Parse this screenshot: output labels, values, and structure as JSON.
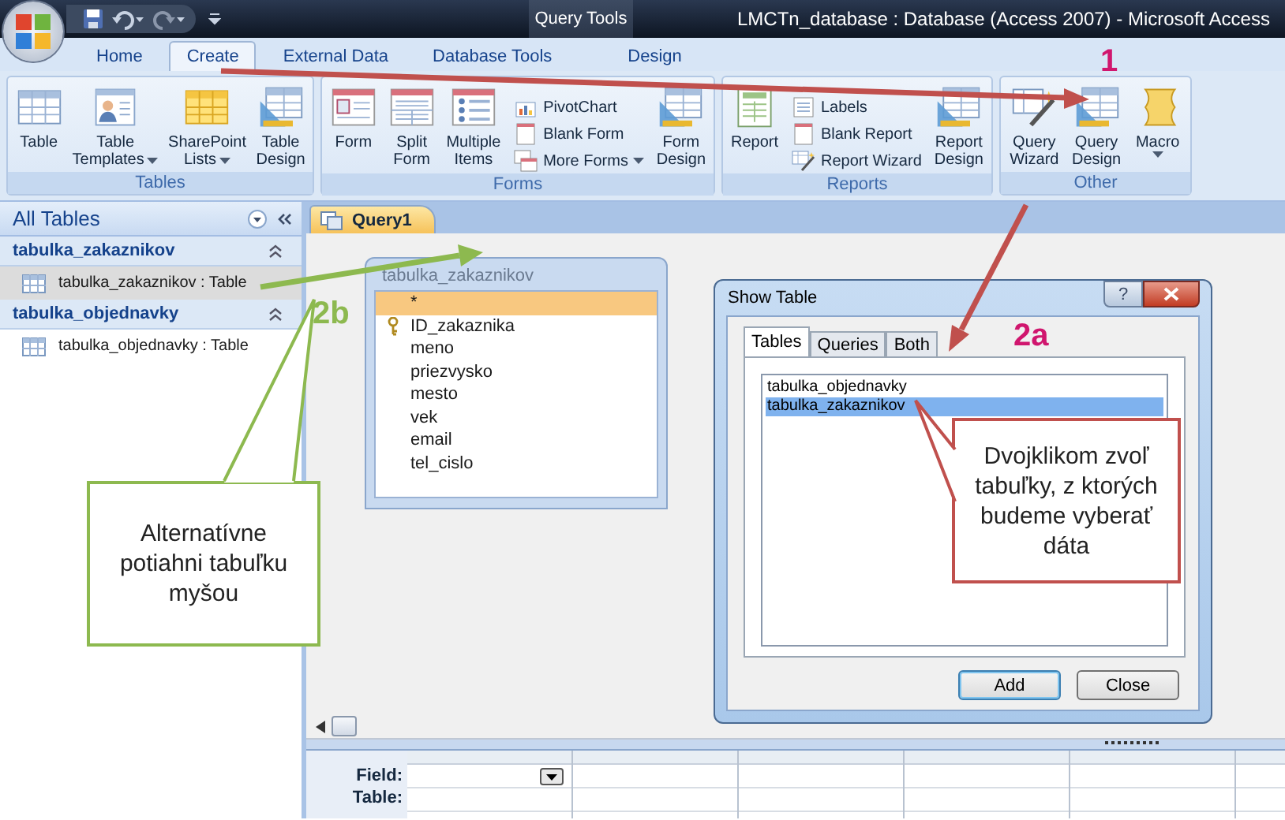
{
  "window": {
    "title": "LMCTn_database : Database (Access 2007) - Microsoft Access",
    "contextual_tab": "Query Tools"
  },
  "ribbon_tabs": [
    {
      "label": "Home",
      "selected": false
    },
    {
      "label": "Create",
      "selected": true
    },
    {
      "label": "External Data",
      "selected": false
    },
    {
      "label": "Database Tools",
      "selected": false
    },
    {
      "label": "Design",
      "selected": false
    }
  ],
  "ribbon_groups": [
    {
      "label": "Tables",
      "commands": [
        {
          "kind": "large",
          "lines": [
            "Table"
          ],
          "dropdown": false
        },
        {
          "kind": "large",
          "lines": [
            "Table",
            "Templates"
          ],
          "dropdown": true
        },
        {
          "kind": "large",
          "lines": [
            "SharePoint",
            "Lists"
          ],
          "dropdown": true
        },
        {
          "kind": "large",
          "lines": [
            "Table",
            "Design"
          ],
          "dropdown": false
        }
      ]
    },
    {
      "label": "Forms",
      "commands": [
        {
          "kind": "large",
          "lines": [
            "Form"
          ],
          "dropdown": false
        },
        {
          "kind": "large",
          "lines": [
            "Split",
            "Form"
          ],
          "dropdown": false
        },
        {
          "kind": "large",
          "lines": [
            "Multiple",
            "Items"
          ],
          "dropdown": false
        },
        {
          "kind": "stack",
          "items": [
            {
              "label": "PivotChart",
              "dropdown": false
            },
            {
              "label": "Blank Form",
              "dropdown": false
            },
            {
              "label": "More Forms",
              "dropdown": true
            }
          ]
        },
        {
          "kind": "large",
          "lines": [
            "Form",
            "Design"
          ],
          "dropdown": false
        }
      ]
    },
    {
      "label": "Reports",
      "commands": [
        {
          "kind": "large",
          "lines": [
            "Report"
          ],
          "dropdown": false
        },
        {
          "kind": "stack",
          "items": [
            {
              "label": "Labels",
              "dropdown": false
            },
            {
              "label": "Blank Report",
              "dropdown": false
            },
            {
              "label": "Report Wizard",
              "dropdown": false
            }
          ]
        },
        {
          "kind": "large",
          "lines": [
            "Report",
            "Design"
          ],
          "dropdown": false
        }
      ]
    },
    {
      "label": "Other",
      "commands": [
        {
          "kind": "large",
          "lines": [
            "Query",
            "Wizard"
          ],
          "dropdown": false
        },
        {
          "kind": "large",
          "lines": [
            "Query",
            "Design"
          ],
          "dropdown": false
        },
        {
          "kind": "large",
          "lines": [
            "Macro"
          ],
          "dropdown": true
        }
      ]
    }
  ],
  "navigation": {
    "title": "All Tables",
    "groups": [
      {
        "label": "tabulka_zakaznikov",
        "expanded": true,
        "items": [
          {
            "label": "tabulka_zakaznikov : Table",
            "selected": true
          }
        ]
      },
      {
        "label": "tabulka_objednavky",
        "expanded": true,
        "items": [
          {
            "label": "tabulka_objednavky : Table",
            "selected": false
          }
        ]
      }
    ]
  },
  "document_tabs": [
    {
      "label": "Query1",
      "selected": true
    }
  ],
  "field_list": {
    "title": "tabulka_zakaznikov",
    "fields": [
      {
        "name": "*",
        "selected": true,
        "primary_key": false
      },
      {
        "name": "ID_zakaznika",
        "selected": false,
        "primary_key": true
      },
      {
        "name": "meno",
        "selected": false,
        "primary_key": false
      },
      {
        "name": "priezvysko",
        "selected": false,
        "primary_key": false
      },
      {
        "name": "mesto",
        "selected": false,
        "primary_key": false
      },
      {
        "name": "vek",
        "selected": false,
        "primary_key": false
      },
      {
        "name": "email",
        "selected": false,
        "primary_key": false
      },
      {
        "name": "tel_cislo",
        "selected": false,
        "primary_key": false
      }
    ]
  },
  "design_grid": {
    "row_labels": [
      "Field:",
      "Table:"
    ]
  },
  "dialog": {
    "title": "Show Table",
    "help_glyph": "?",
    "tabs": [
      {
        "label": "Tables",
        "selected": true
      },
      {
        "label": "Queries",
        "selected": false
      },
      {
        "label": "Both",
        "selected": false
      }
    ],
    "items": [
      {
        "label": "tabulka_objednavky",
        "selected": false
      },
      {
        "label": "tabulka_zakaznikov",
        "selected": true
      }
    ],
    "buttons": [
      {
        "label": "Add",
        "default": true
      },
      {
        "label": "Close",
        "default": false
      }
    ]
  },
  "annotations": [
    {
      "kind": "step",
      "text": "1",
      "color": "#d0166e"
    },
    {
      "kind": "step",
      "text": "2a",
      "color": "#d0166e"
    },
    {
      "kind": "step",
      "text": "2b",
      "color": "#8db94f"
    },
    {
      "kind": "callout",
      "text": "Alternatívne potiahni tabuľku myšou",
      "color": "#8db94f"
    },
    {
      "kind": "callout",
      "text": "Dvojklikom zvoľ tabuľky, z ktorých budeme vyberať dáta",
      "color": "#c0504d"
    }
  ]
}
